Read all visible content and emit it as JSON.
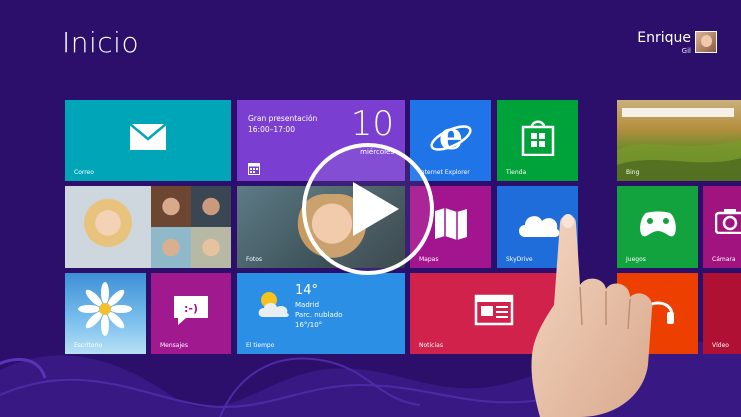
{
  "start": {
    "title": "Inicio"
  },
  "user": {
    "first_name": "Enrique",
    "last_name": "Gil"
  },
  "tiles": {
    "mail": {
      "label": "Correo",
      "icon": "envelope-icon"
    },
    "calendar": {
      "event_title": "Gran presentación",
      "event_time": "16:00–17:00",
      "day_number": "10",
      "weekday": "miércoles",
      "icon": "calendar-icon"
    },
    "ie": {
      "label": "Internet Explorer",
      "icon": "ie-icon"
    },
    "store": {
      "label": "Tienda",
      "icon": "store-bag-icon"
    },
    "bing": {
      "label": "Bing"
    },
    "people": {
      "label": ""
    },
    "photos": {
      "label": "Fotos"
    },
    "maps": {
      "label": "Mapas",
      "icon": "map-icon"
    },
    "skydrive": {
      "label": "SkyDrive",
      "icon": "cloud-icon"
    },
    "games": {
      "label": "Juegos",
      "icon": "xbox-controller-icon"
    },
    "camera": {
      "label": "Cámara",
      "icon": "camera-icon"
    },
    "desktop": {
      "label": "Escritorio"
    },
    "messaging": {
      "label": "Mensajes",
      "icon": "smiley-bubble-icon"
    },
    "weather": {
      "label": "El tiempo",
      "temperature": "14°",
      "city": "Madrid",
      "condition": "Parc. nublado",
      "range": "16°/10°",
      "icon": "sun-cloud-icon"
    },
    "news": {
      "label": "Noticias",
      "icon": "newspaper-icon"
    },
    "music": {
      "label": "",
      "icon": "headphones-icon"
    },
    "video": {
      "label": "Vídeo"
    }
  },
  "overlay": {
    "icon": "play-icon"
  },
  "colors": {
    "background": "#2b0f6b",
    "mail": "#00a6b8",
    "calendar": "#7a3fd1",
    "ie": "#1f74e8",
    "store": "#00a23a",
    "maps": "#a3148f",
    "skydrive": "#1f6ddb",
    "games": "#12a33f",
    "messaging": "#a1198f",
    "weather": "#2b8fe6",
    "news": "#d0224a",
    "music": "#ec3f00",
    "video": "#b01033"
  }
}
